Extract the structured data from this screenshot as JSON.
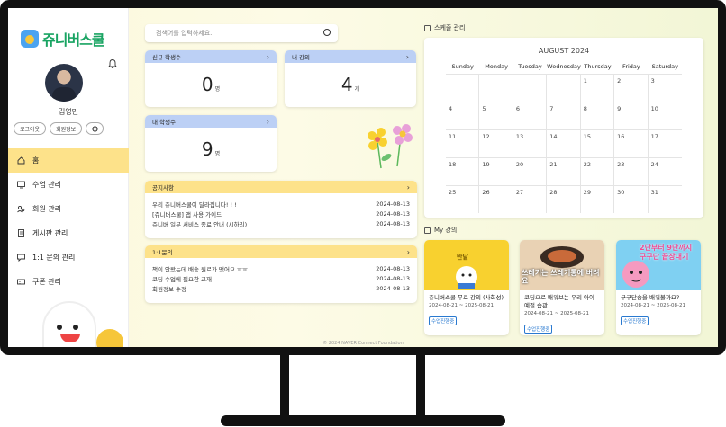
{
  "sidebar": {
    "logo_text": "쥬니버스쿨",
    "username": "김영민",
    "logout": "로그아웃",
    "profile": "회원정보",
    "nav": [
      {
        "label": "홈"
      },
      {
        "label": "수업 관리"
      },
      {
        "label": "회원 관리"
      },
      {
        "label": "게시판 관리"
      },
      {
        "label": "1:1 문의 관리"
      },
      {
        "label": "쿠폰 관리"
      }
    ]
  },
  "search": {
    "placeholder": "검색어를 입력하세요."
  },
  "stats": {
    "new_students": {
      "label": "신규 학생수",
      "value": "0",
      "unit": "명"
    },
    "my_courses": {
      "label": "내 강의",
      "value": "4",
      "unit": "개"
    },
    "my_students": {
      "label": "내 학생수",
      "value": "9",
      "unit": "명"
    }
  },
  "notices": {
    "title": "공지사항",
    "items": [
      {
        "text": "우리 쥬니버스쿨이 달라집니다! ! !",
        "date": "2024-08-13"
      },
      {
        "text": "[쥬니버스쿨] 앱 사용 가이드",
        "date": "2024-08-13"
      },
      {
        "text": "쥬니버 일부 서비스 종료 안내 (시하리)",
        "date": "2024-08-13"
      }
    ]
  },
  "inquiries": {
    "title": "1:1문의",
    "items": [
      {
        "text": "책이 안왔는데 배송 원료가 떴어요 ㅠㅠ",
        "date": "2024-08-13"
      },
      {
        "text": "코딩 수업에 필요한 교재",
        "date": "2024-08-13"
      },
      {
        "text": "회원정보 수정",
        "date": "2024-08-13"
      }
    ]
  },
  "schedule": {
    "title": "스케줄 관리",
    "month": "AUGUST 2024",
    "dow": [
      "Sunday",
      "Monday",
      "Tuesday",
      "Wednesday",
      "Thursday",
      "Friday",
      "Saturday"
    ],
    "weeks": [
      [
        "",
        "",
        "",
        "",
        "1",
        "2",
        "3"
      ],
      [
        "4",
        "5",
        "6",
        "7",
        "8",
        "9",
        "10"
      ],
      [
        "11",
        "12",
        "13",
        "14",
        "15",
        "16",
        "17"
      ],
      [
        "18",
        "19",
        "20",
        "21",
        "22",
        "23",
        "24"
      ],
      [
        "25",
        "26",
        "27",
        "28",
        "29",
        "30",
        "31"
      ]
    ]
  },
  "my_courses": {
    "title": "My 강의",
    "items": [
      {
        "title": "쥬니버스쿨 무료 강의 (사회성)",
        "date": "2024-08-21 ~ 2025-08-21",
        "badge": "수업진행중",
        "thumb_text": "반달"
      },
      {
        "title": "코딩으로 배워보는 우리 아이 예절 습관",
        "date": "2024-08-21 ~ 2025-08-21",
        "badge": "수업진행중",
        "thumb_text": "쓰레기는 쓰레기통에 버려요"
      },
      {
        "title": "구구단송을 배워볼까요?",
        "date": "2024-08-21 ~ 2025-08-21",
        "badge": "수업진행중",
        "thumb_text": "2단부터 9단까지 구구단 끝장내기"
      }
    ]
  },
  "footer": "© 2024 NAVER Connect Foundation",
  "colors": {
    "accent_yellow": "#fde28a",
    "accent_blue": "#bcd0f5",
    "logo_green": "#1aa463"
  }
}
